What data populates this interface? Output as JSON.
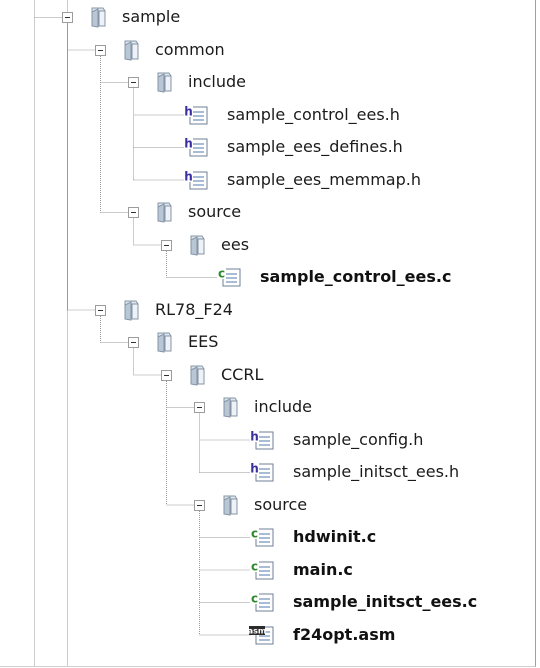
{
  "tree": {
    "nodes": [
      {
        "label": "sample",
        "type": "folder",
        "depth": 0,
        "bold": false
      },
      {
        "label": "common",
        "type": "folder",
        "depth": 1,
        "bold": false
      },
      {
        "label": "include",
        "type": "folder",
        "depth": 2,
        "bold": false
      },
      {
        "label": "sample_control_ees.h",
        "type": "file-h",
        "depth": 3,
        "bold": false
      },
      {
        "label": "sample_ees_defines.h",
        "type": "file-h",
        "depth": 3,
        "bold": false
      },
      {
        "label": "sample_ees_memmap.h",
        "type": "file-h",
        "depth": 3,
        "bold": false
      },
      {
        "label": "source",
        "type": "folder",
        "depth": 2,
        "bold": false
      },
      {
        "label": "ees",
        "type": "folder",
        "depth": 3,
        "bold": false
      },
      {
        "label": "sample_control_ees.c",
        "type": "file-c",
        "depth": 4,
        "bold": true
      },
      {
        "label": "RL78_F24",
        "type": "folder",
        "depth": 1,
        "bold": false
      },
      {
        "label": "EES",
        "type": "folder",
        "depth": 2,
        "bold": false
      },
      {
        "label": "CCRL",
        "type": "folder",
        "depth": 3,
        "bold": false
      },
      {
        "label": "include",
        "type": "folder",
        "depth": 4,
        "bold": false
      },
      {
        "label": "sample_config.h",
        "type": "file-h",
        "depth": 5,
        "bold": false
      },
      {
        "label": "sample_initsct_ees.h",
        "type": "file-h",
        "depth": 5,
        "bold": false
      },
      {
        "label": "source",
        "type": "folder",
        "depth": 4,
        "bold": false
      },
      {
        "label": "hdwinit.c",
        "type": "file-c",
        "depth": 5,
        "bold": true
      },
      {
        "label": "main.c",
        "type": "file-c",
        "depth": 5,
        "bold": true
      },
      {
        "label": "sample_initsct_ees.c",
        "type": "file-c",
        "depth": 5,
        "bold": true
      },
      {
        "label": "f24opt.asm",
        "type": "file-asm",
        "depth": 5,
        "bold": true
      }
    ]
  },
  "icons": {
    "folder": "folder-icon",
    "file-h": "header-file-icon",
    "file-c": "c-source-file-icon",
    "file-asm": "asm-file-icon"
  },
  "icon_glyphs": {
    "file-h": "h",
    "file-c": "c",
    "file-asm": "asm"
  },
  "colors": {
    "tree_line": "#9a9a9a",
    "folder_body": "#dfe6ee",
    "folder_front": "#b9c6d4",
    "folder_outline": "#8494a6",
    "h_badge": "#3a2ea0",
    "c_badge": "#2f8a2f",
    "asm_badge": "#2b2b2b"
  }
}
